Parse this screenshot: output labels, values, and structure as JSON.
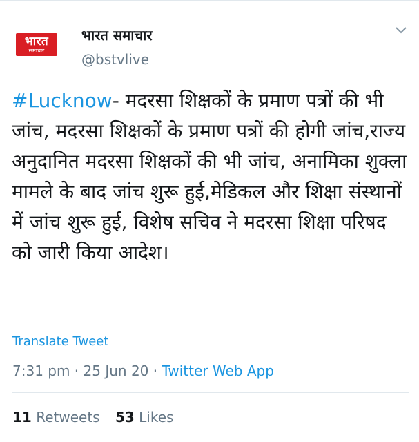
{
  "header": {
    "avatar_logo_main": "भारत",
    "avatar_logo_sub": "समाचार",
    "display_name": "भारत समाचार",
    "handle": "@bstvlive",
    "menu_icon": "chevron-down-icon"
  },
  "tweet": {
    "hashtag": "#Lucknow",
    "text": "- मदरसा शिक्षकों के प्रमाण पत्रों की भी जांच, मदरसा शिक्षकों के प्रमाण पत्रों की होगी जांच,राज्य अनुदानित मदरसा शिक्षकों की भी जांच, अनामिका शुक्ला मामले के बाद जांच शुरू हुई,मेडिकल और शिक्षा संस्थानों में जांच शुरू हुई, विशेष सचिव ने मदरसा शिक्षा परिषद को जारी किया आदेश।",
    "translate_label": "Translate Tweet",
    "time": "7:31 pm",
    "separator": " · ",
    "date": "25 Jun 20",
    "source": "Twitter Web App"
  },
  "stats": {
    "retweets_count": "11",
    "retweets_label": "Retweets",
    "likes_count": "53",
    "likes_label": "Likes"
  },
  "colors": {
    "link": "#1b95e0",
    "secondary_text": "#657786",
    "primary_text": "#14171a",
    "brand_red": "#d91e24"
  }
}
